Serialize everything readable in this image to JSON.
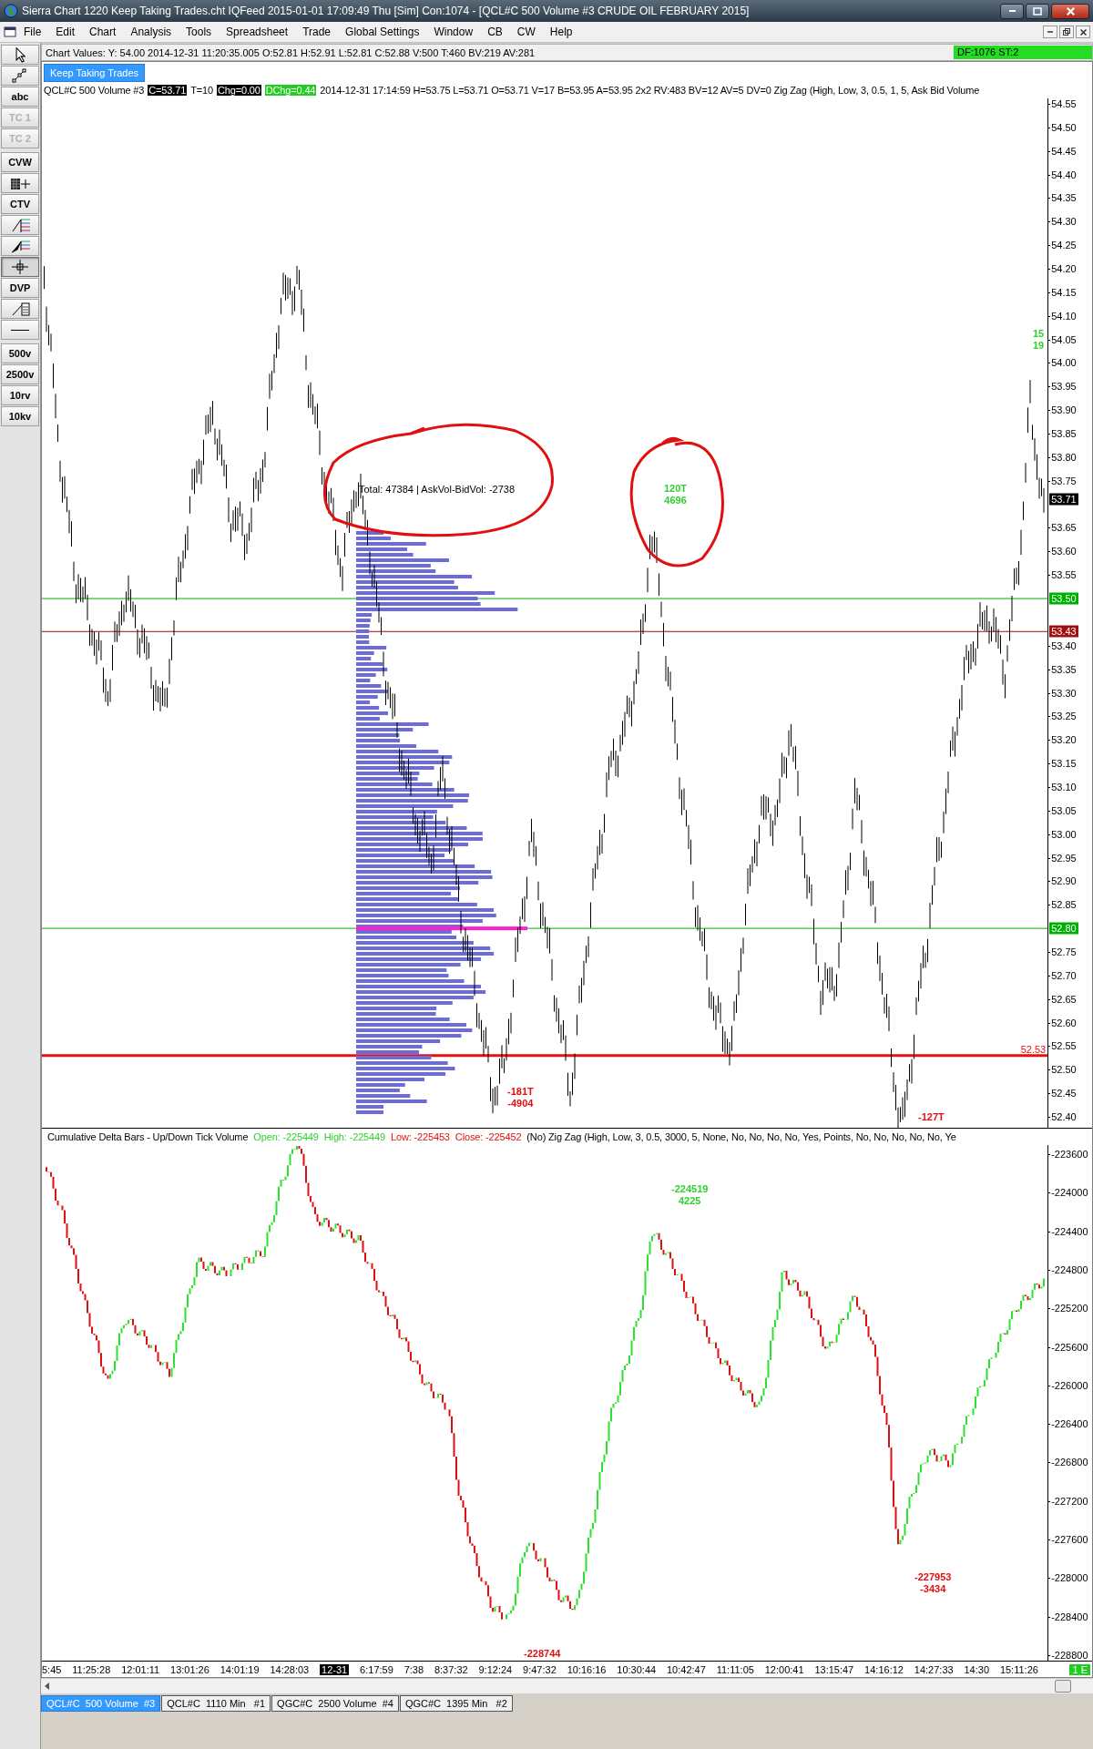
{
  "window": {
    "title": "Sierra Chart 1220 Keep Taking Trades.cht  IQFeed 2015-01-01  17:09:49 Thu  [Sim]  Con:1074 - [QCL#C  500 Volume  #3  CRUDE OIL FEBRUARY 2015]"
  },
  "menu": [
    "File",
    "Edit",
    "Chart",
    "Analysis",
    "Tools",
    "Spreadsheet",
    "Trade",
    "Global Settings",
    "Window",
    "CB",
    "CW",
    "Help"
  ],
  "tools": [
    {
      "kind": "pointer",
      "selected": false
    },
    {
      "kind": "line",
      "selected": false
    },
    {
      "kind": "text",
      "label": "abc",
      "disabled": false,
      "selected": false
    },
    {
      "kind": "text",
      "label": "TC 1",
      "disabled": true,
      "selected": false
    },
    {
      "kind": "text",
      "label": "TC 2",
      "disabled": true,
      "selected": false
    },
    {
      "kind": "text",
      "label": "CVW",
      "disabled": false,
      "selected": false
    },
    {
      "kind": "grid",
      "selected": false
    },
    {
      "kind": "text",
      "label": "CTV",
      "disabled": false,
      "selected": false
    },
    {
      "kind": "fib",
      "selected": false
    },
    {
      "kind": "fibext",
      "selected": false
    },
    {
      "kind": "crosshair",
      "selected": true
    },
    {
      "kind": "text",
      "label": "DVP",
      "disabled": false,
      "selected": false
    },
    {
      "kind": "calc",
      "selected": false
    },
    {
      "kind": "hline",
      "selected": false
    },
    {
      "kind": "text",
      "label": "500v",
      "disabled": false,
      "selected": false
    },
    {
      "kind": "text",
      "label": "2500v",
      "disabled": false,
      "selected": false
    },
    {
      "kind": "text",
      "label": "10rv",
      "disabled": false,
      "selected": false
    },
    {
      "kind": "text",
      "label": "10kv",
      "disabled": false,
      "selected": false
    }
  ],
  "chart_values": {
    "text": "Chart Values: Y: 54.00  2014-12-31  11:20:35.005  O:52.81  H:52.91  L:52.81  C:52.88  V:500  T:460  BV:219  AV:281",
    "status": "DF:1076  ST:2"
  },
  "chartbook_tab": "Keep Taking Trades",
  "study_line": [
    {
      "text": "QCL#C  500 Volume  #3",
      "kind": "plain"
    },
    {
      "text": "C=53.71",
      "kind": "inverse"
    },
    {
      "text": "T=10",
      "kind": "plain"
    },
    {
      "text": "Chg=0.00",
      "kind": "inverse"
    },
    {
      "text": "DChg=0.44",
      "kind": "green"
    },
    {
      "text": "2014-12-31 17:14:59 H=53.75 L=53.71 O=53.71 V=17 B=53.95 A=53.95 2x2 RV:483 BV=12 AV=5 DV=0 Zig Zag  (High, Low, 3, 0.5, 1, 5, Ask Bid Volume",
      "kind": "plain"
    }
  ],
  "price_axis": [
    "54.55",
    "54.50",
    "54.45",
    "54.40",
    "54.35",
    "54.30",
    "54.25",
    "54.20",
    "54.15",
    "54.10",
    "54.05",
    "54.00",
    "53.95",
    "53.90",
    "53.85",
    "53.80",
    "53.75",
    "53.65",
    "53.60",
    "53.55",
    "53.40",
    "53.35",
    "53.30",
    "53.25",
    "53.20",
    "53.15",
    "53.10",
    "53.05",
    "53.00",
    "52.95",
    "52.90",
    "52.85",
    "52.75",
    "52.70",
    "52.65",
    "52.60",
    "52.55",
    "52.50",
    "52.45",
    "52.40"
  ],
  "current_price": "53.71",
  "price_lines": [
    {
      "label": "53.50",
      "color": "#00b000",
      "kind": "tag"
    },
    {
      "label": "53.43",
      "color": "#a01010",
      "kind": "tag"
    },
    {
      "label": "52.80",
      "color": "#00b000",
      "kind": "tag"
    },
    {
      "label": "52.53",
      "color": "#e81010",
      "kind": "inline"
    }
  ],
  "profile_note": "Total: 47384 | AskVol-BidVol: -2738",
  "zigzag_labels": [
    {
      "lines": [
        "15",
        "19"
      ],
      "color": "#30d030"
    },
    {
      "lines": [
        "120T",
        "4696"
      ],
      "color": "#30d030"
    },
    {
      "lines": [
        "-181T",
        "-4904"
      ],
      "color": "#e01010"
    },
    {
      "lines": [
        "-127T"
      ],
      "color": "#e01010"
    }
  ],
  "delta_header": [
    {
      "text": "Cumulative Delta Bars - Up/Down Tick Volume",
      "color": "#000000"
    },
    {
      "text": "Open: -225449",
      "color": "#30d030"
    },
    {
      "text": "High: -225449",
      "color": "#30d030"
    },
    {
      "text": "Low: -225453",
      "color": "#e01010"
    },
    {
      "text": "Close: -225452",
      "color": "#e01010"
    },
    {
      "text": "(No)  Zig Zag  (High, Low, 3, 0.5, 3000, 5, None, No, No, No, No, Yes, Points, No, No, No, No, No, Ye",
      "color": "#000000"
    }
  ],
  "delta_axis": [
    "-223600",
    "-224000",
    "-224400",
    "-224800",
    "-225200",
    "-225600",
    "-226000",
    "-226400",
    "-226800",
    "-227200",
    "-227600",
    "-228000",
    "-228400",
    "-228800"
  ],
  "delta_labels": [
    {
      "lines": [
        "-224519",
        "4225"
      ],
      "color": "#30d030"
    },
    {
      "lines": [
        "-227953",
        "-3434"
      ],
      "color": "#e01010"
    },
    {
      "lines": [
        "-228744"
      ],
      "color": "#e01010"
    }
  ],
  "time_axis": [
    {
      "label": "5:45",
      "kind": "time"
    },
    {
      "label": "11:25:28",
      "kind": "time"
    },
    {
      "label": "12:01:11",
      "kind": "time"
    },
    {
      "label": "13:01:26",
      "kind": "time"
    },
    {
      "label": "14:01:19",
      "kind": "time"
    },
    {
      "label": "14:28:03",
      "kind": "time"
    },
    {
      "label": "12-31",
      "kind": "date"
    },
    {
      "label": "6:17:59",
      "kind": "time"
    },
    {
      "label": "7:38",
      "kind": "time"
    },
    {
      "label": "8:37:32",
      "kind": "time"
    },
    {
      "label": "9:12:24",
      "kind": "time"
    },
    {
      "label": "9:47:32",
      "kind": "time"
    },
    {
      "label": "10:16:16",
      "kind": "time"
    },
    {
      "label": "10:30:44",
      "kind": "time"
    },
    {
      "label": "10:42:47",
      "kind": "time"
    },
    {
      "label": "11:11:05",
      "kind": "time"
    },
    {
      "label": "12:00:41",
      "kind": "time"
    },
    {
      "label": "13:15:47",
      "kind": "time"
    },
    {
      "label": "14:16:12",
      "kind": "time"
    },
    {
      "label": "14:27:33",
      "kind": "time"
    },
    {
      "label": "14:30",
      "kind": "time"
    },
    {
      "label": "15:11:26",
      "kind": "time"
    }
  ],
  "end_marker": "1 E",
  "chart_tabs": [
    {
      "label": "QCL#C  500 Volume  #3",
      "selected": true
    },
    {
      "label": "QCL#C  1110 Min   #1",
      "selected": false
    },
    {
      "label": "QGC#C  2500 Volume  #4",
      "selected": false
    },
    {
      "label": "QGC#C  1395 Min   #2",
      "selected": false
    }
  ]
}
